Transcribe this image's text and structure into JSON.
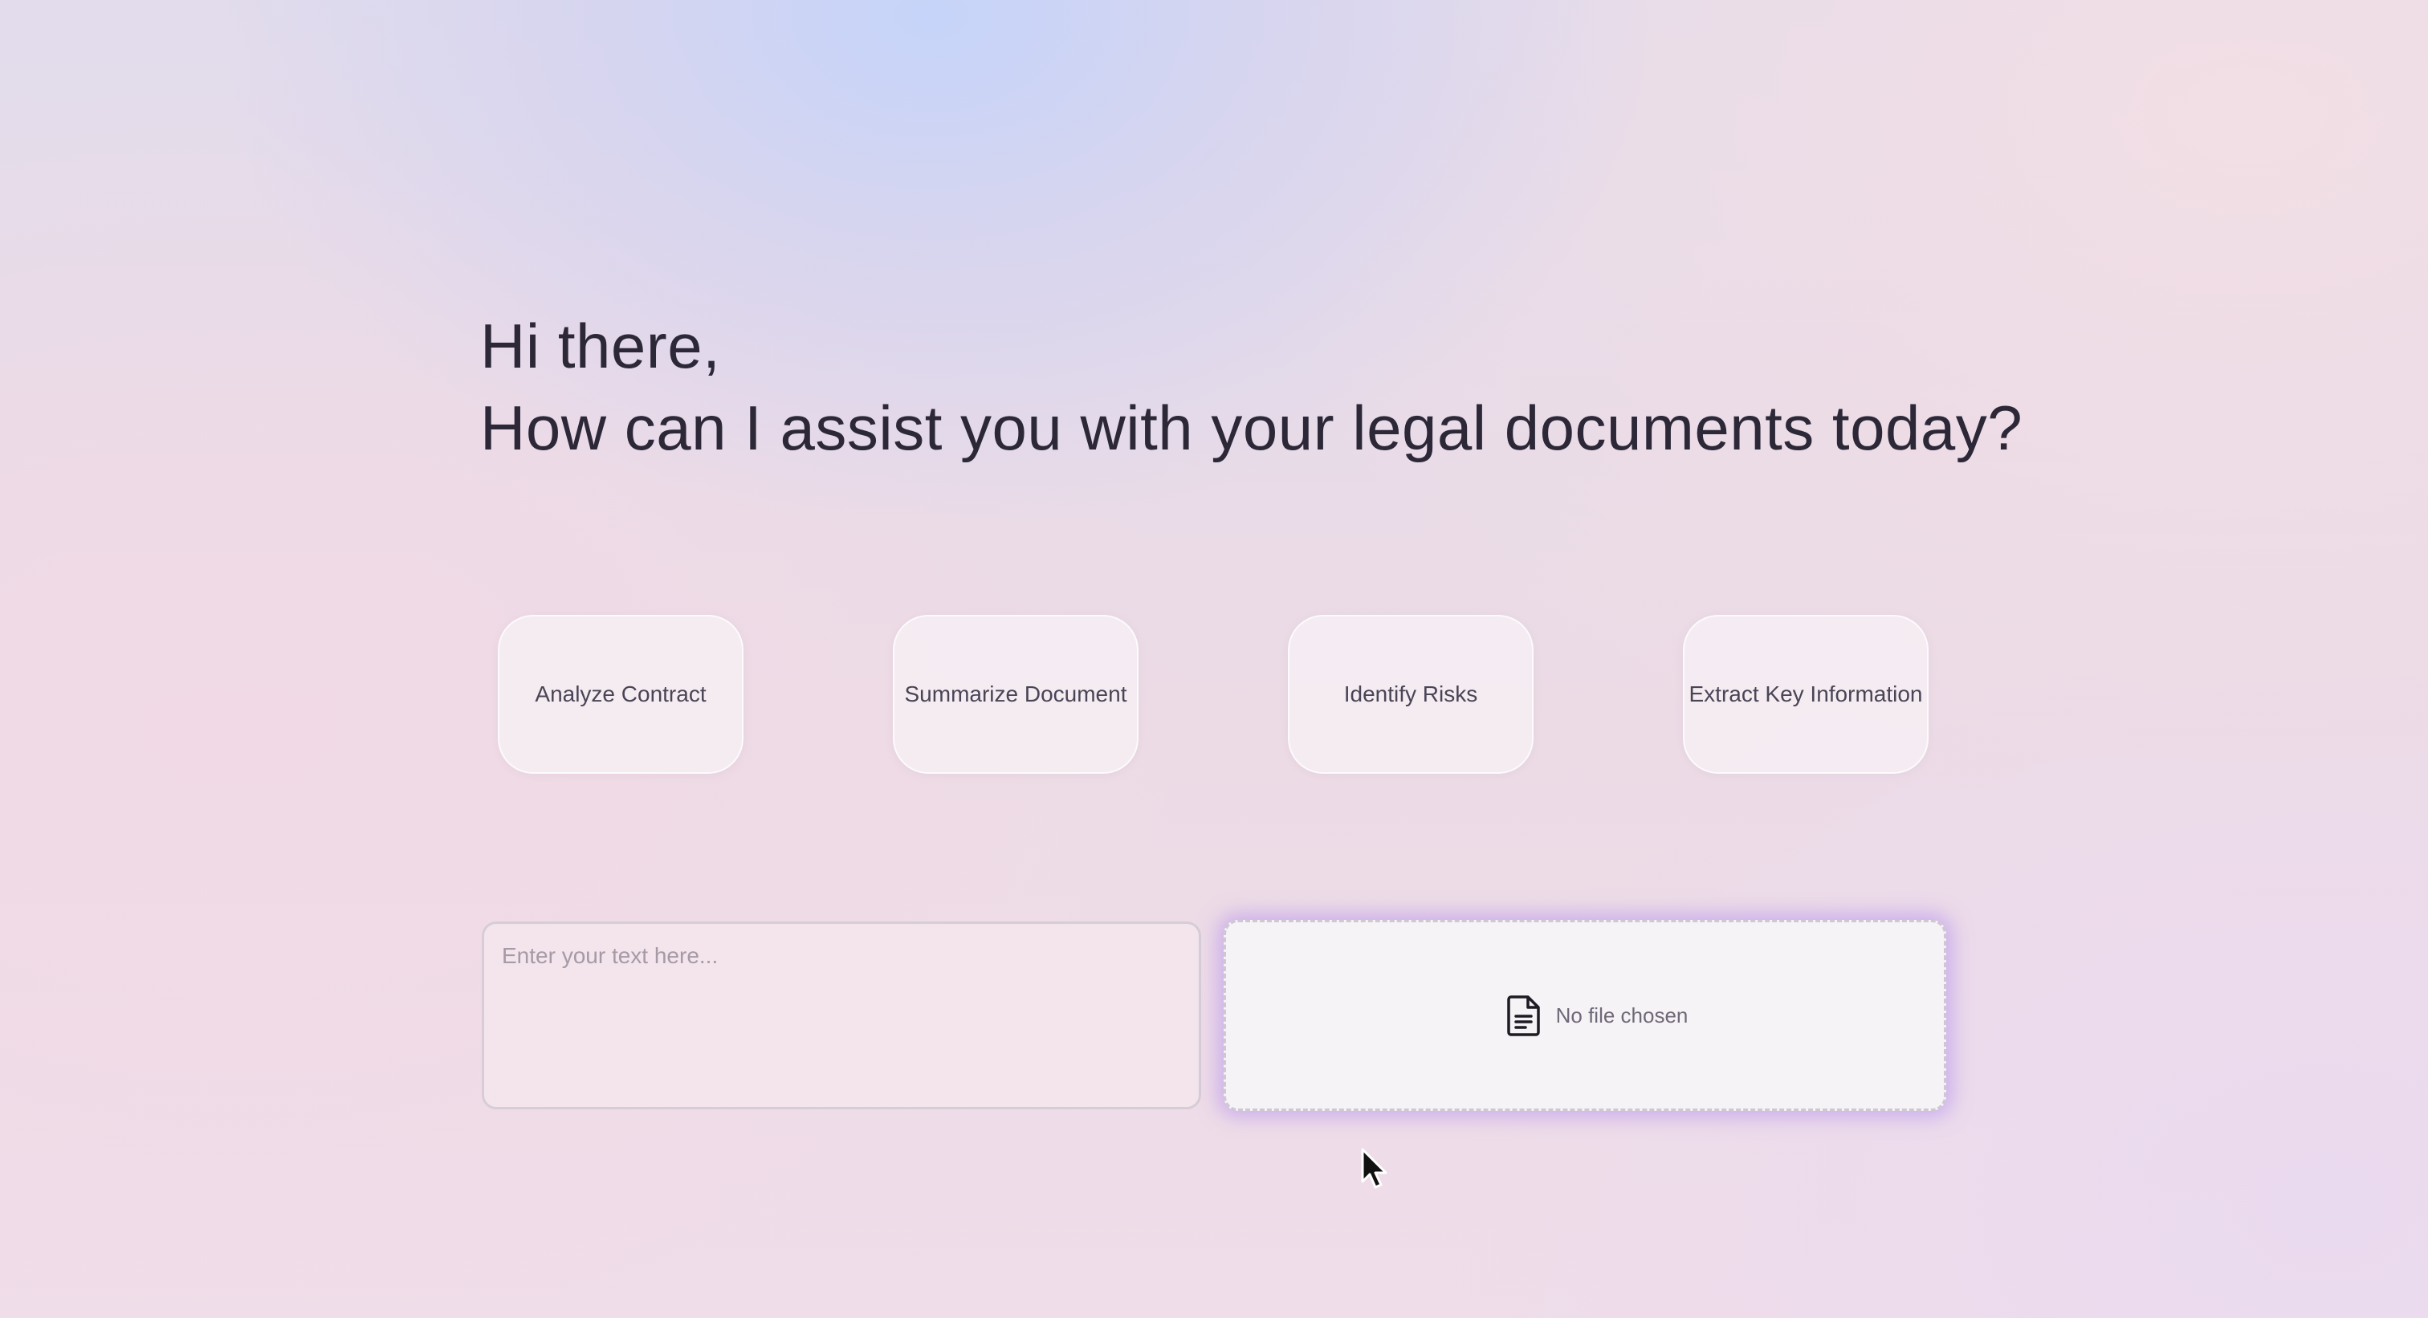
{
  "greeting": {
    "line1": "Hi there,",
    "line2": "How can I assist you with your legal documents today?"
  },
  "actions": [
    {
      "label": "Analyze Contract"
    },
    {
      "label": "Summarize Document"
    },
    {
      "label": "Identify Risks"
    },
    {
      "label": "Extract Key Information"
    }
  ],
  "text_input": {
    "placeholder": "Enter your text here...",
    "value": ""
  },
  "file_upload": {
    "icon": "document-icon",
    "status": "No file chosen"
  },
  "colors": {
    "upload_glow": "#b08cec",
    "text": "#2c2838"
  }
}
